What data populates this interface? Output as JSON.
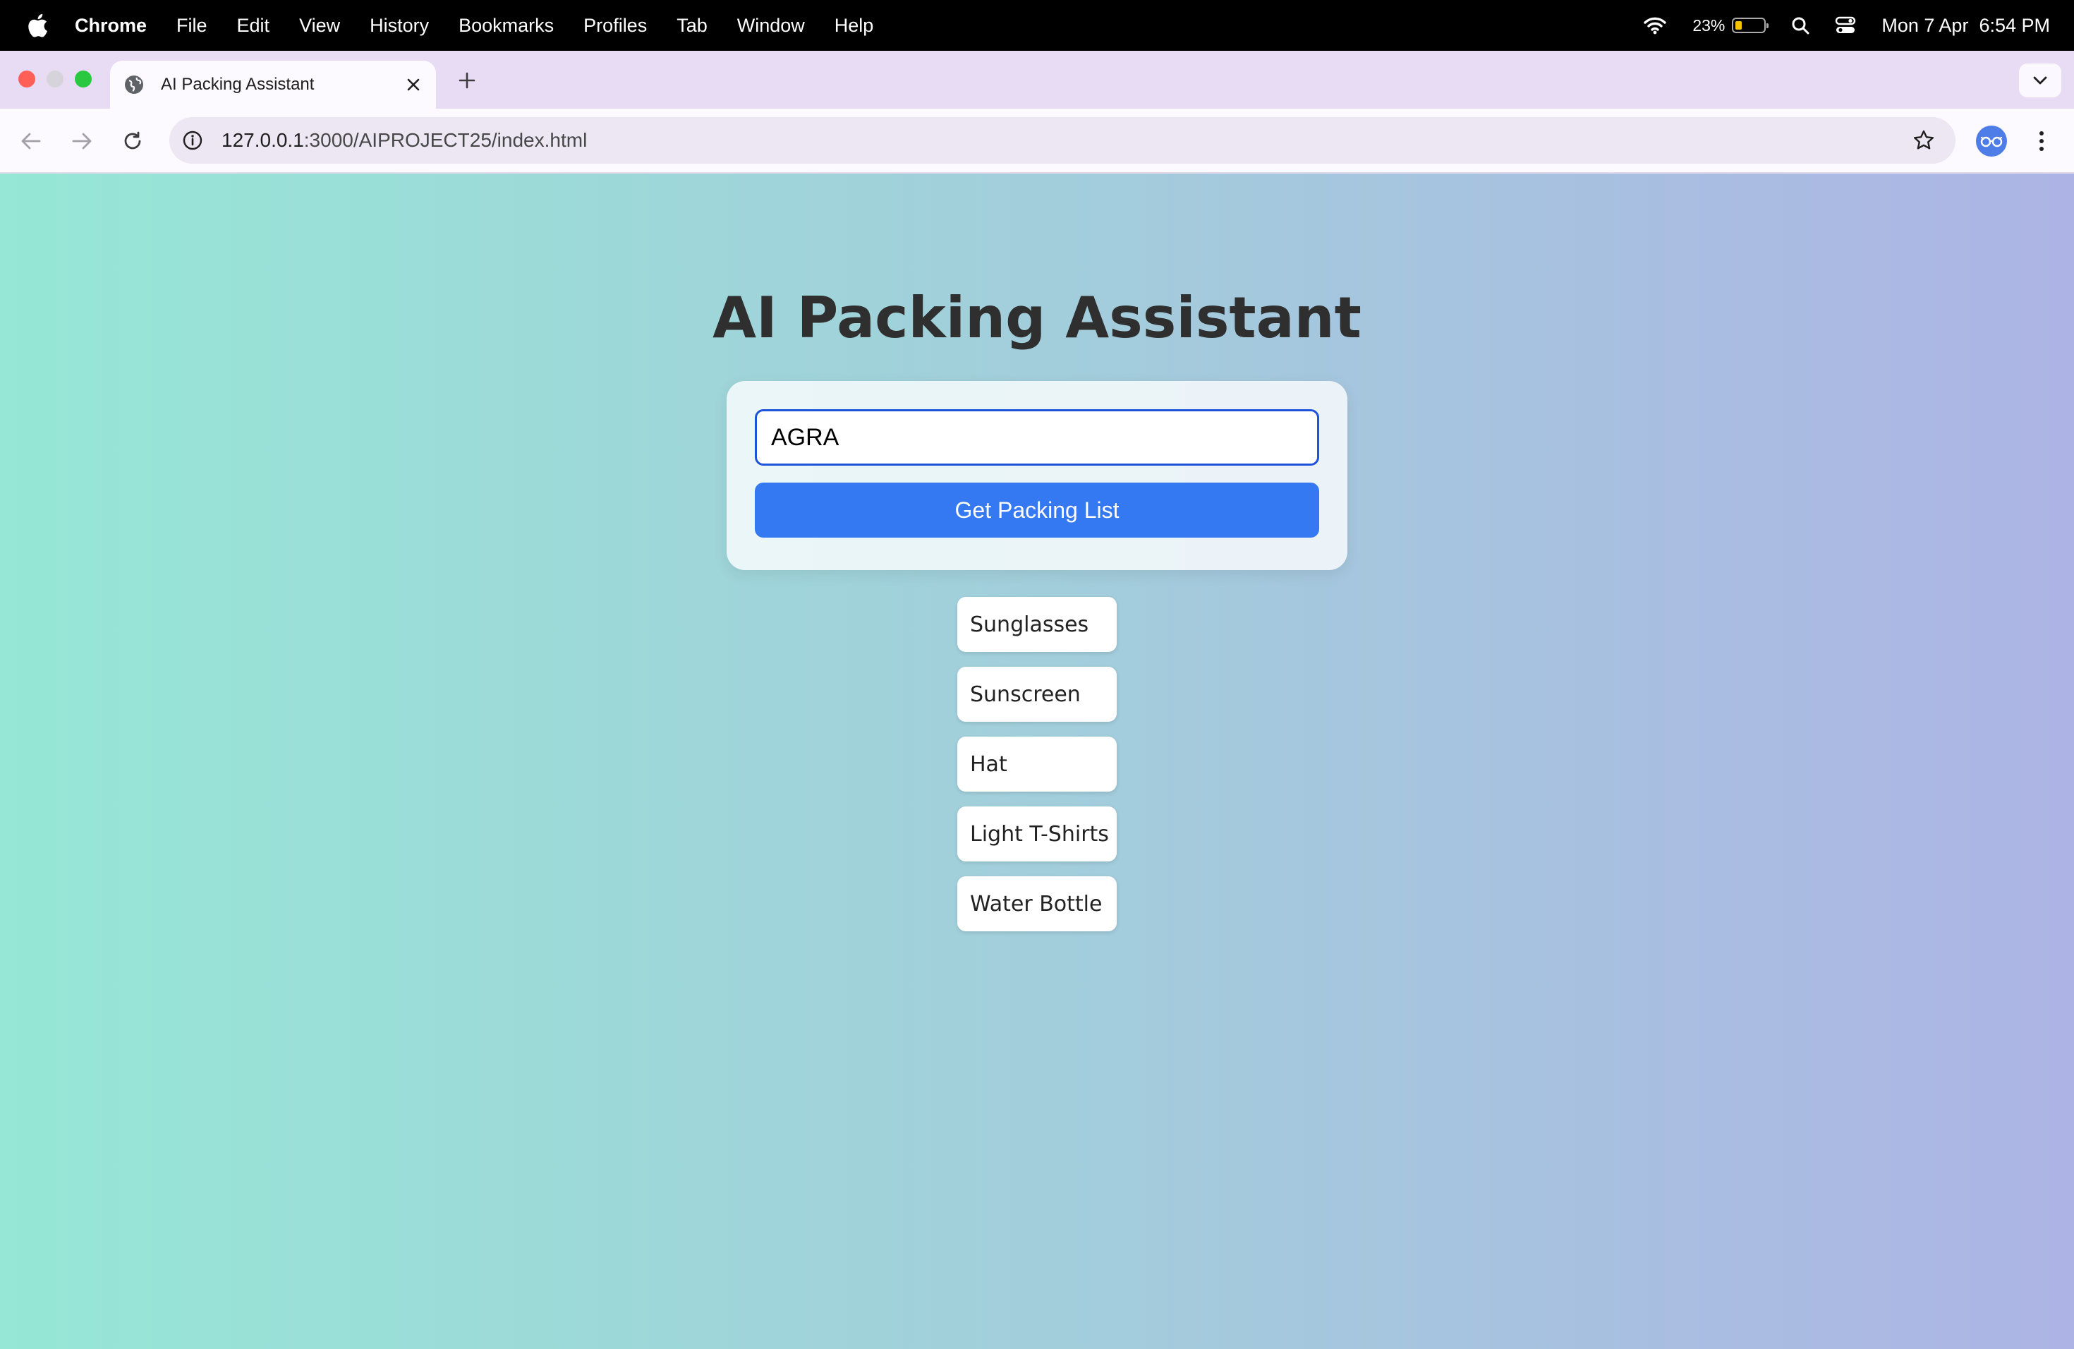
{
  "menubar": {
    "app_name": "Chrome",
    "items": [
      "File",
      "Edit",
      "View",
      "History",
      "Bookmarks",
      "Profiles",
      "Tab",
      "Window",
      "Help"
    ],
    "battery_percent": "23%",
    "battery_level": 0.23,
    "datetime": "Mon 7 Apr  6:54 PM"
  },
  "tabs": [
    {
      "title": "AI Packing Assistant",
      "active": true
    }
  ],
  "toolbar": {
    "url_host": "127.0.0.1",
    "url_rest": ":3000/AIPROJECT25/index.html"
  },
  "page": {
    "title": "AI Packing Assistant",
    "destination_value": "AGRA",
    "button_label": "Get Packing List",
    "packing_items": [
      "Sunglasses",
      "Sunscreen",
      "Hat",
      "Light T-Shirts",
      "Water Bottle"
    ]
  },
  "colors": {
    "accent_button": "#3478f2",
    "input_focus_border": "#1d53d8",
    "gradient_start": "#96e7d6",
    "gradient_end": "#adb4e5"
  },
  "icons": {
    "apple": "apple-logo-icon",
    "wifi": "wifi-icon",
    "battery": "battery-icon",
    "spotlight": "search-icon",
    "control_center": "control-center-icon",
    "favicon": "globe-icon",
    "tab_close": "close-icon",
    "new_tab": "plus-icon",
    "tab_search": "chevron-down-icon",
    "back": "arrow-left-icon",
    "forward": "arrow-right-icon",
    "reload": "reload-icon",
    "site_info": "info-icon",
    "bookmark": "star-icon",
    "profile": "profile-avatar-icon",
    "menu": "kebab-menu-icon"
  }
}
